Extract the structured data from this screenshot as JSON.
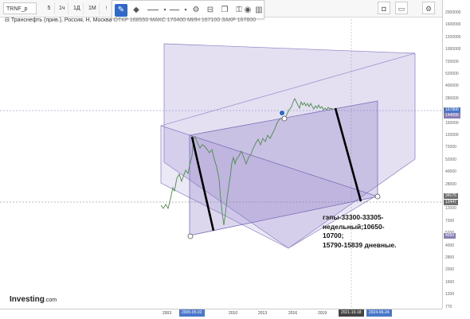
{
  "toolbar": {
    "symbol": "TRNF_p",
    "intervals": [
      "5",
      "1ч",
      "1Д",
      "1М"
    ],
    "drawing_tools": [
      "pencil-icon",
      "fill-icon",
      "line-style-icon",
      "line-width-icon",
      "settings-icon",
      "template-icon",
      "copy-icon",
      "lock-icon",
      "eye-icon",
      "trash-icon"
    ],
    "right_tools": [
      "camera-icon",
      "layout-icon",
      "settings-icon",
      "fullscreen-icon"
    ]
  },
  "legend": {
    "title": "Транснефть (прив.), Россия, Н, Москва",
    "ohlc": "ОТКР 168550  МАКС 170400  МИН 167100  ЗАКР 167800"
  },
  "price_axis": {
    "labels": [
      "2000000",
      "1600000",
      "1200000",
      "1000000",
      "720000",
      "520000",
      "400000",
      "280000",
      "200000",
      "160000",
      "120000",
      "72000",
      "52000",
      "40000",
      "28000",
      "20000",
      "12000",
      "7200",
      "5200",
      "4000",
      "2800",
      "2000",
      "1600",
      "1200",
      "770"
    ],
    "tags": [
      {
        "text": "167800",
        "color": "#4a77c9"
      },
      {
        "text": "144090",
        "color": "#8b7fb8"
      },
      {
        "text": "34175",
        "color": "#6f6f6f"
      },
      {
        "text": "12447",
        "color": "#6f6f6f"
      },
      {
        "text": "4050",
        "color": "#8b7fb8"
      }
    ]
  },
  "time_axis": {
    "labels": [
      "2003",
      "2010",
      "2013",
      "2016",
      "2019"
    ],
    "tags": [
      {
        "text": "2005-05-02",
        "color": "#4a77c9"
      },
      {
        "text": "2021-10-18",
        "color": "#444444"
      },
      {
        "text": "2024-06-24",
        "color": "#4a77c9"
      }
    ]
  },
  "annotation": {
    "lines": [
      "гэпы-33300-33305-",
      "недельный;10650-",
      "10700;",
      "15790-15839 дневные."
    ]
  },
  "logo": {
    "brand": "Investing",
    "suffix": ".com"
  },
  "colors": {
    "channel_fill": "#8e7fc4",
    "channel_stroke": "#7e6fb8",
    "candles": "#4e8a4e",
    "trend_lines": "#000000",
    "handle": "#2f68c8"
  }
}
